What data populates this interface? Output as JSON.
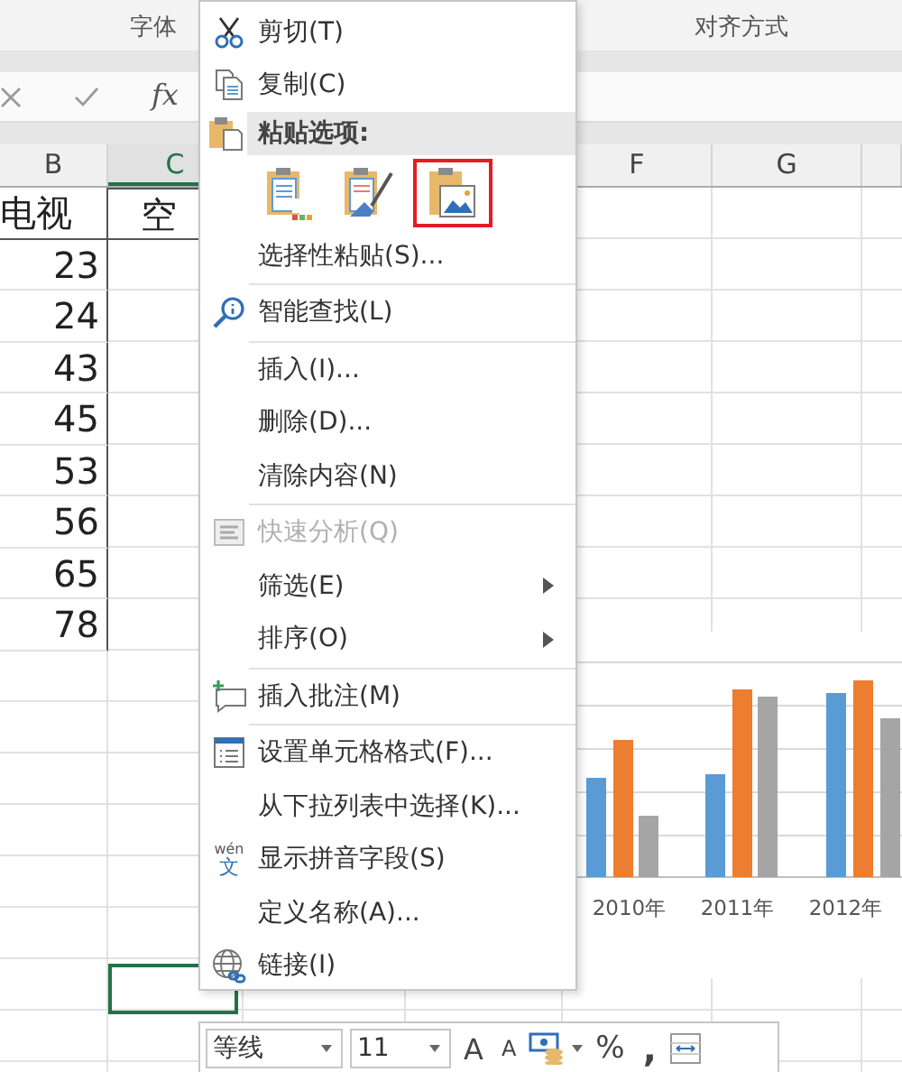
{
  "ribbon": {
    "groups": [
      "字体",
      "对齐方式"
    ]
  },
  "formula_bar": {
    "function_label": "fx"
  },
  "columns": [
    {
      "label": "B",
      "selected": false
    },
    {
      "label": "C",
      "selected": true
    },
    {
      "label": "F",
      "selected": false
    },
    {
      "label": "G",
      "selected": false
    }
  ],
  "rows": [
    {
      "b": "电视",
      "c": "空"
    },
    {
      "b": "23"
    },
    {
      "b": "24"
    },
    {
      "b": "43"
    },
    {
      "b": "45"
    },
    {
      "b": "53"
    },
    {
      "b": "56"
    },
    {
      "b": "65"
    },
    {
      "b": "78"
    }
  ],
  "chart": {
    "category_labels": [
      "2010年",
      "2011年",
      "2012年"
    ]
  },
  "context_menu": {
    "items": [
      {
        "kind": "item",
        "label": "剪切(T)",
        "disabled": false,
        "submenu": false
      },
      {
        "kind": "item",
        "label": "复制(C)",
        "disabled": false,
        "submenu": false
      },
      {
        "kind": "header",
        "label": "粘贴选项:"
      },
      {
        "kind": "paste-options",
        "options": [
          {
            "selected": false
          },
          {
            "selected": false
          },
          {
            "selected": true
          }
        ]
      },
      {
        "kind": "item",
        "label": "选择性粘贴(S)...",
        "disabled": false,
        "submenu": false
      },
      {
        "kind": "separator"
      },
      {
        "kind": "item",
        "label": "智能查找(L)",
        "disabled": false,
        "submenu": false
      },
      {
        "kind": "separator"
      },
      {
        "kind": "item",
        "label": "插入(I)...",
        "disabled": false,
        "submenu": false
      },
      {
        "kind": "item",
        "label": "删除(D)...",
        "disabled": false,
        "submenu": false
      },
      {
        "kind": "item",
        "label": "清除内容(N)",
        "disabled": false,
        "submenu": false
      },
      {
        "kind": "separator"
      },
      {
        "kind": "item",
        "label": "快速分析(Q)",
        "disabled": true,
        "submenu": false
      },
      {
        "kind": "item",
        "label": "筛选(E)",
        "disabled": false,
        "submenu": true
      },
      {
        "kind": "item",
        "label": "排序(O)",
        "disabled": false,
        "submenu": true
      },
      {
        "kind": "separator"
      },
      {
        "kind": "item",
        "label": "插入批注(M)",
        "disabled": false,
        "submenu": false
      },
      {
        "kind": "separator"
      },
      {
        "kind": "item",
        "label": "设置单元格格式(F)...",
        "disabled": false,
        "submenu": false
      },
      {
        "kind": "item",
        "label": "从下拉列表中选择(K)...",
        "disabled": false,
        "submenu": false
      },
      {
        "kind": "item",
        "label": "显示拼音字段(S)",
        "disabled": false,
        "submenu": false,
        "icon_text": [
          "wén",
          "文"
        ]
      },
      {
        "kind": "item",
        "label": "定义名称(A)...",
        "disabled": false,
        "submenu": false
      },
      {
        "kind": "item",
        "label": "链接(I)",
        "disabled": false,
        "submenu": false
      }
    ]
  },
  "mini_toolbar": {
    "font": "等线",
    "size": "11",
    "grow_font": "A",
    "shrink_font": "A",
    "percent": "%",
    "comma": ","
  }
}
